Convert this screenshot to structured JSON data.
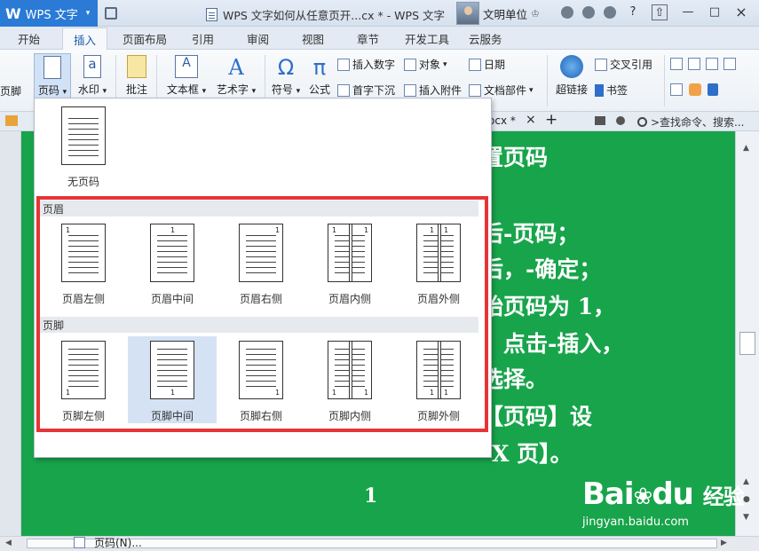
{
  "app": {
    "logo_text": "W",
    "name": "WPS 文字",
    "menu_caret": "▾"
  },
  "window": {
    "title": "WPS 文字如何从任意页开...cx * - WPS 文字",
    "user": "文明单位"
  },
  "tabs": [
    "开始",
    "插入",
    "页面布局",
    "引用",
    "审阅",
    "视图",
    "章节",
    "开发工具",
    "云服务"
  ],
  "active_tab": "插入",
  "ribbon": {
    "footer_partial": "页脚",
    "page_number": "页码",
    "watermark": "水印",
    "comment": "批注",
    "textbox": "文本框",
    "wordart": "艺术字",
    "symbol": "符号",
    "formula": "公式",
    "insert_number": "插入数字",
    "object": "对象",
    "date": "日期",
    "drop_cap": "首字下沉",
    "attachment": "插入附件",
    "doc_parts": "文档部件",
    "hyperlink": "超链接",
    "cross_ref": "交叉引用",
    "bookmark": "书签",
    "caret": "▾"
  },
  "doctabs": {
    "tab_partial": "ocx *",
    "close": "×",
    "add": "+",
    "search": ">查找命令、搜索..."
  },
  "document": {
    "lines": [
      "置页码",
      "后-页码；",
      "后，-确定；",
      "始页码为 1，",
      "，点击-插入，",
      "选择。",
      "【页码】设",
      "页】。"
    ],
    "x_text": "X 页】。",
    "page_number": "1"
  },
  "menu": {
    "none": "无页码",
    "header_group": "页眉",
    "footer_group": "页脚",
    "header_opts": [
      "页眉左侧",
      "页眉中间",
      "页眉右侧",
      "页眉内侧",
      "页眉外侧"
    ],
    "footer_opts": [
      "页脚左侧",
      "页脚中间",
      "页脚右侧",
      "页脚内侧",
      "页脚外侧"
    ],
    "more": "页码(N)...",
    "highlighted": "页脚中间",
    "sample_number": "1"
  },
  "watermark": {
    "brand": "Bai",
    "brand2": "du",
    "cn": "经验",
    "url": "jingyan.baidu.com"
  },
  "colors": {
    "page_green": "#18a44b",
    "highlight_box": "#e63436",
    "app_blue": "#2a7ad6"
  }
}
